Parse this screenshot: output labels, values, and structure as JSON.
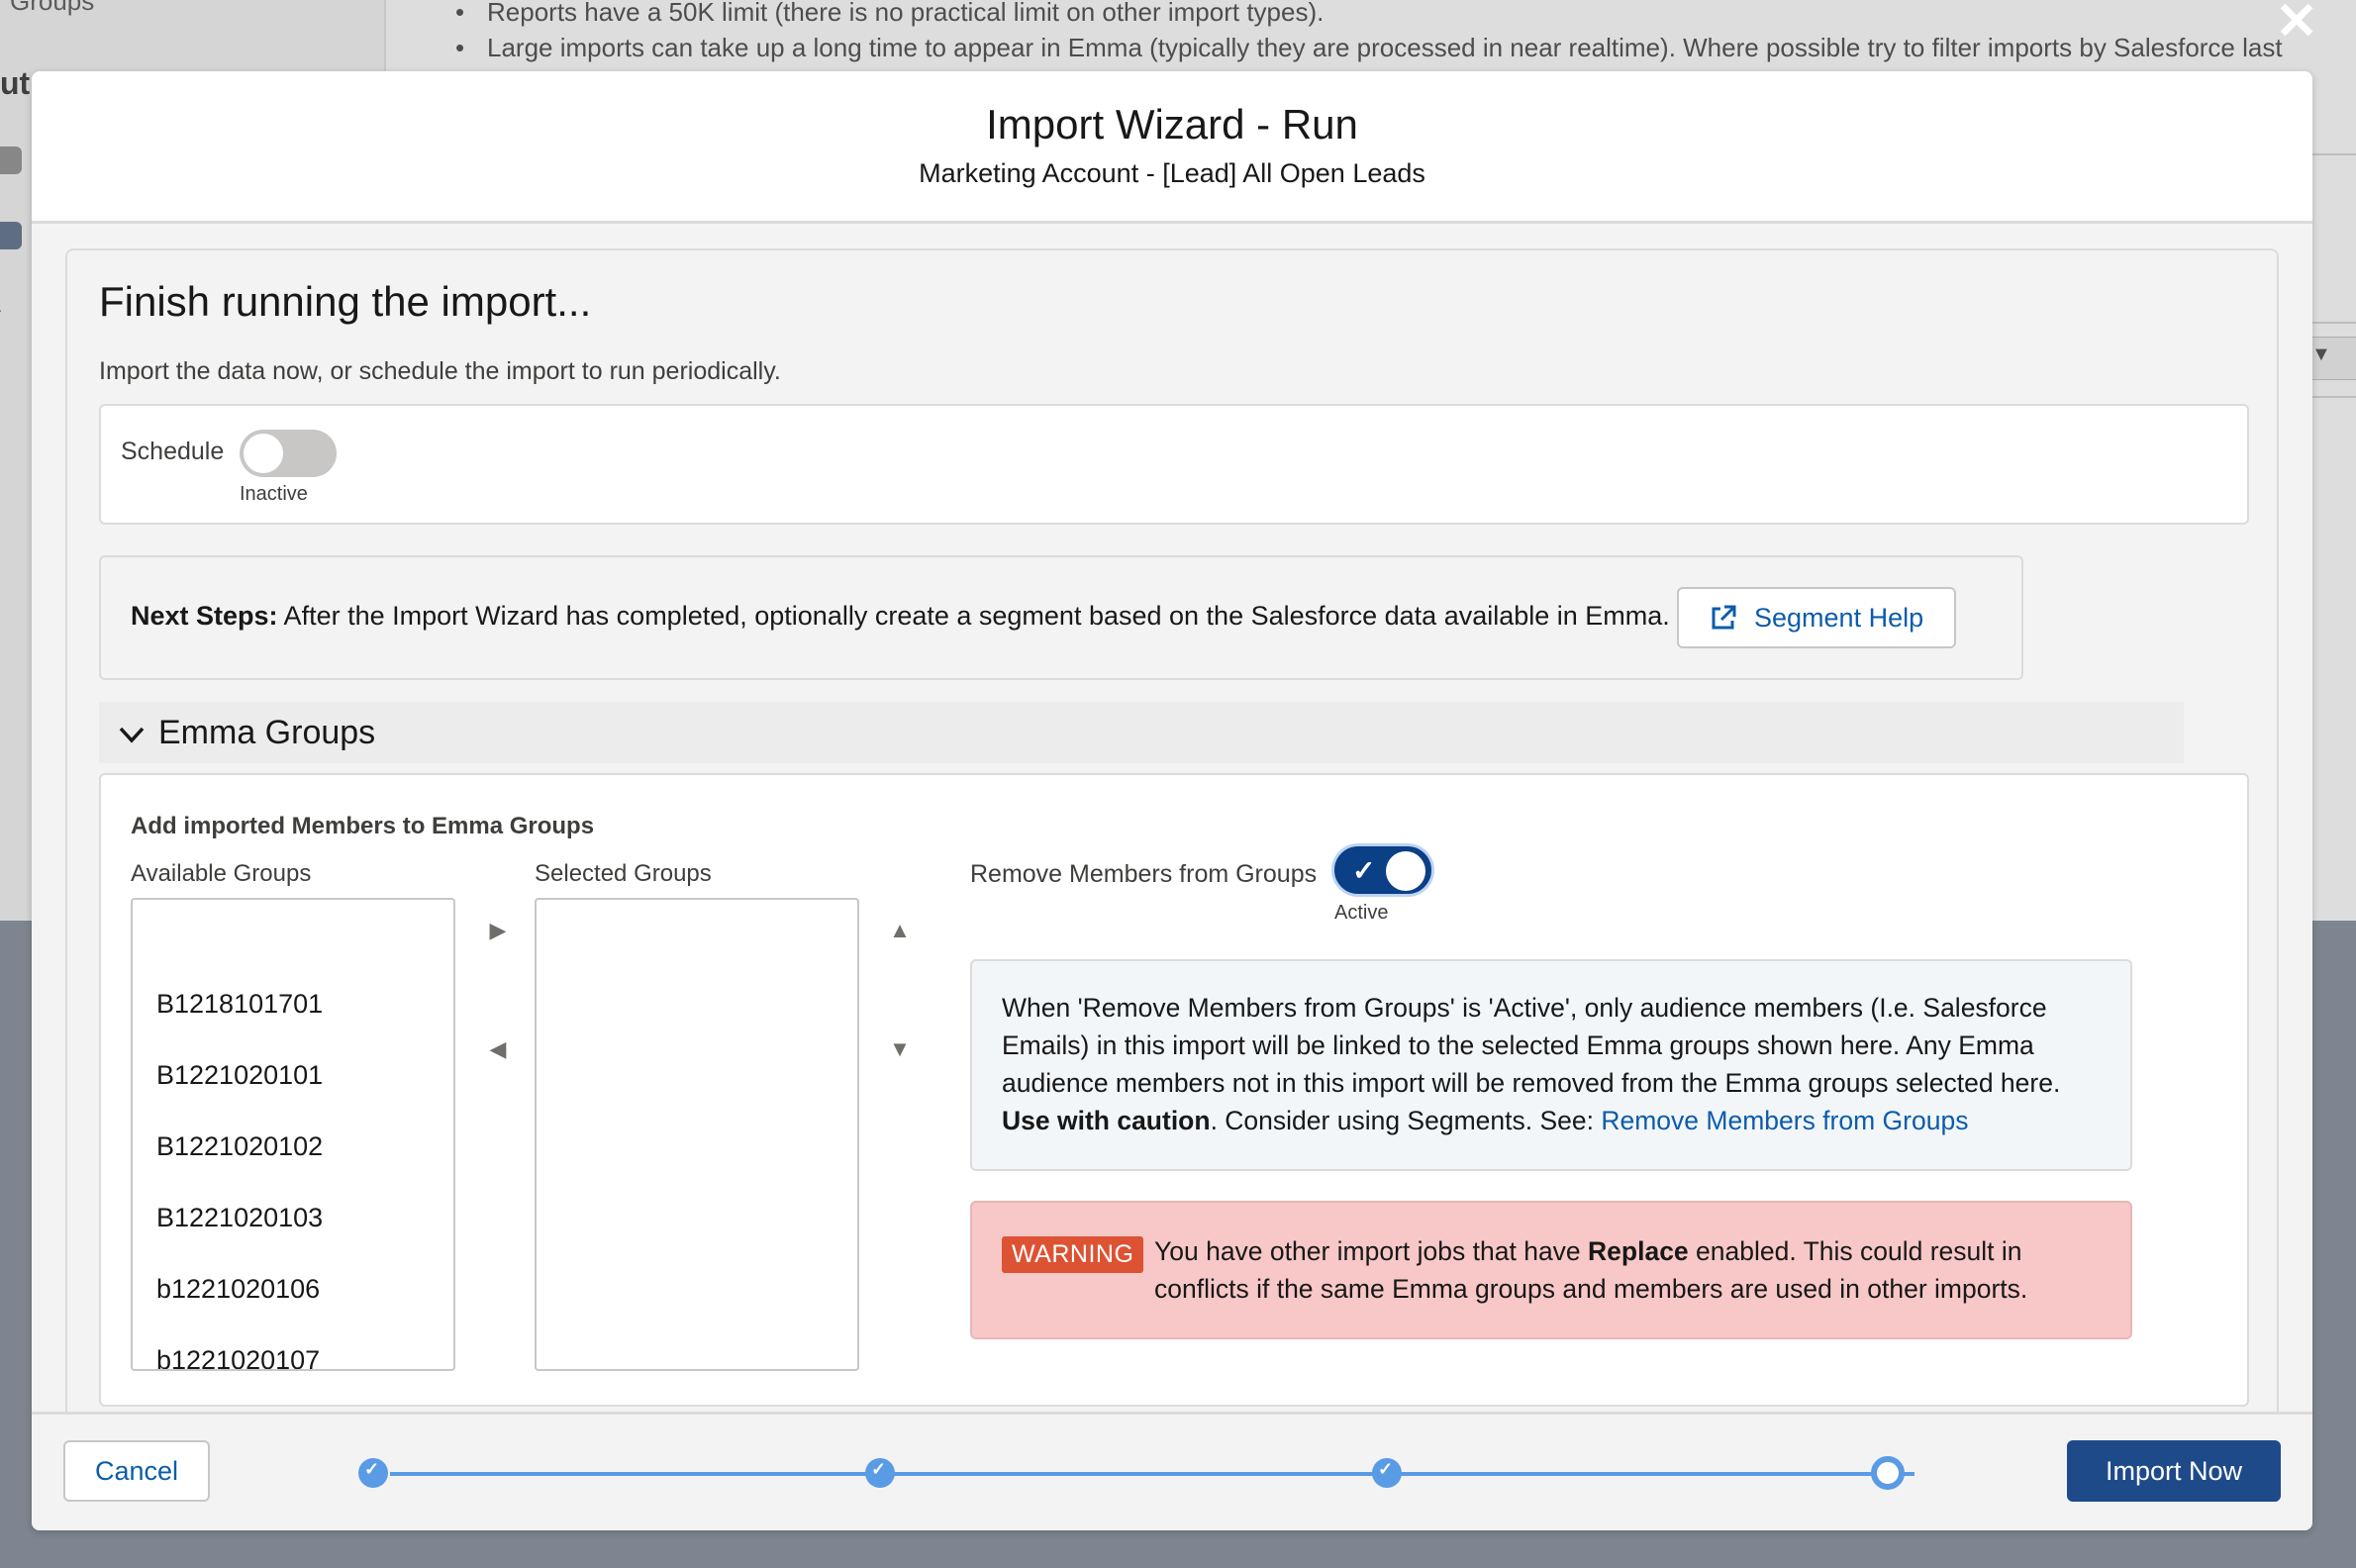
{
  "background": {
    "left_header": "Groups",
    "left_partial": "ut",
    "bullets": [
      "Reports have a 50K limit (there is no practical limit on other import types).",
      "Large imports can take up a long time to appear in Emma (typically they are processed in near realtime). Where possible try to filter imports by Salesforce last modified"
    ],
    "dropdown_icon": "chevron-down-icon"
  },
  "close_icon": "close-icon",
  "modal": {
    "title": "Import Wizard - Run",
    "subtitle": "Marketing Account - [Lead] All Open Leads"
  },
  "finish": {
    "heading": "Finish running the import...",
    "description": "Import the data now, or schedule the import to run periodically."
  },
  "schedule": {
    "label": "Schedule",
    "status": "Inactive",
    "enabled": false
  },
  "next_steps": {
    "label": "Next Steps:",
    "text": " After the Import Wizard has completed, optionally create a segment based on the Salesforce data available in Emma.",
    "button_label": "Segment Help",
    "button_icon": "external-link-icon"
  },
  "emma_groups": {
    "section_title": "Emma Groups",
    "heading": "Add imported Members to Emma Groups",
    "available_label": "Available Groups",
    "selected_label": "Selected Groups",
    "available_items": [
      "B1218101701",
      "B1221020101",
      "B1221020102",
      "B1221020103",
      "b1221020106",
      "b1221020107"
    ],
    "selected_items": [],
    "remove_label": "Remove Members from Groups",
    "remove_status": "Active",
    "remove_enabled": true,
    "info_part1": "When 'Remove Members from Groups' is 'Active', only audience members (I.e. Salesforce Emails) in this import will be linked to the selected Emma groups shown here. Any Emma audience members not in this import will be removed from the Emma groups selected here. ",
    "info_bold": "Use with caution",
    "info_part2": ". Consider using Segments. See: ",
    "info_link": "Remove Members from Groups",
    "warning_badge": "WARNING",
    "warning_part1": "You have other import jobs that have ",
    "warning_bold": "Replace",
    "warning_part2": " enabled. This could result in conflicts if the same Emma groups and members are used in other imports."
  },
  "footer": {
    "cancel_label": "Cancel",
    "import_label": "Import Now",
    "steps_total": 4,
    "steps_completed": 3
  },
  "colors": {
    "brand": "#1f4a8a",
    "link": "#0b5cab",
    "warning": "#dd5233",
    "warning_bg": "#f7c8c7",
    "progress": "#5a9be6"
  }
}
